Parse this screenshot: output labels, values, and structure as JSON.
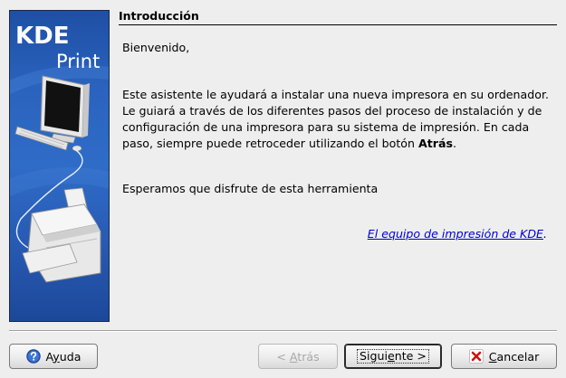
{
  "header": {
    "title": "Introducción"
  },
  "banner": {
    "logo_kde": "KDE",
    "logo_print": "Print"
  },
  "content": {
    "welcome": "Bienvenido,",
    "body_lines": [
      "Este asistente le ayudará a instalar una nueva impresora en su ordenador.",
      "Le guiará a través de los diferentes pasos del proceso de instalación y de",
      "configuración de una impresora para su sistema de impresión. En cada",
      "paso, siempre puede retroceder utilizando el botón "
    ],
    "body_bold": "Atrás",
    "body_end": ".",
    "enjoy": "Esperamos que disfrute de esta herramienta",
    "team_link": "El equipo de impresión de KDE",
    "team_link_suffix": "."
  },
  "buttons": {
    "help": {
      "prefix": "A",
      "mnemonic": "y",
      "suffix": "uda",
      "icon": "help-icon"
    },
    "back": {
      "prefix": "< ",
      "mnemonic": "A",
      "suffix": "trás",
      "enabled": false
    },
    "next": {
      "prefix": "Sigui",
      "mnemonic": "e",
      "suffix": "nte >",
      "default": true
    },
    "cancel": {
      "prefix": "",
      "mnemonic": "C",
      "suffix": "ancelar",
      "icon": "close-icon"
    }
  },
  "colors": {
    "banner_blue": "#2f6cc8",
    "link": "#0000cc",
    "window_bg": "#eeeeee",
    "cancel_icon_red": "#d01010",
    "help_icon_blue": "#2a5cc0"
  }
}
